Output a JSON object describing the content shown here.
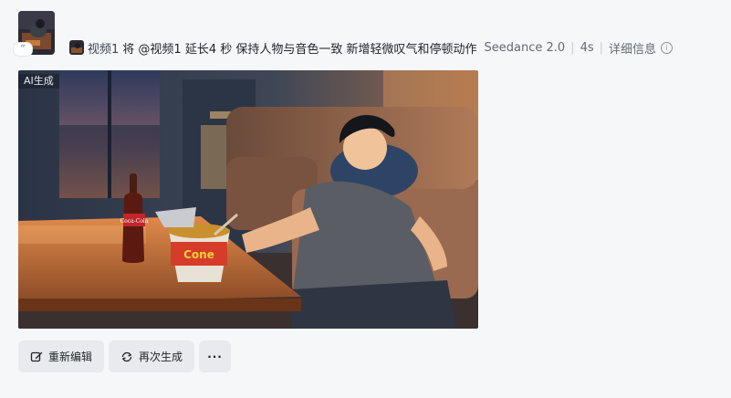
{
  "reference": {
    "thumbnail_icon": "video-reference-thumbnail",
    "quote_glyph": "“"
  },
  "prompt": {
    "video_ref": "视频1",
    "text": "将 @视频1 延长4 秒 保持人物与音色一致 新增轻微叹气和停顿动作",
    "model": "Seedance 2.0",
    "separator": "|",
    "duration": "4s",
    "detail_label": "详细信息",
    "info_icon_glyph": "i"
  },
  "media": {
    "ai_badge": "AI生成",
    "bottle_label": "Coca-Cola",
    "cup_label": "Cone"
  },
  "actions": {
    "reedit_label": "重新编辑",
    "regenerate_label": "再次生成",
    "more_label": "···"
  }
}
